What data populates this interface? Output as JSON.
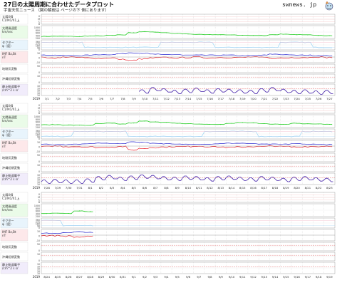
{
  "header": {
    "title": "27日の太陽周期に合わせたデータプロット",
    "subtitle": "宇宙天気ニュース （図の解説は ページの下 側にあります）",
    "logo_text": "swnews. jp"
  },
  "row_labels": [
    {
      "lines": [
        "太陽X線",
        "C1/M1/X1上"
      ],
      "bg": "#ffffff"
    },
    {
      "lines": [
        "太陽風速度",
        "km/sec"
      ],
      "bg": "#eafbe8"
    },
    {
      "lines": [
        "セクター",
        "φ（度）"
      ],
      "bg": "#e8f4fc"
    },
    {
      "lines": [
        "IMF Bz,Bt",
        "nT"
      ],
      "bg": "#fde8ea"
    },
    {
      "lines": [
        "地磁気変動"
      ],
      "bg": "#ffffff"
    },
    {
      "lines": [
        "沖縄短期変動"
      ],
      "bg": "#ffffff"
    },
    {
      "lines": [
        "静止軌道電子",
        "/cm^2 s sr"
      ],
      "bg": "#f1ecfb"
    }
  ],
  "axis_labels": {
    "xray": [
      "X",
      "M",
      "C",
      "B"
    ],
    "wind": [
      "1000",
      "800",
      "600",
      "400",
      "200"
    ],
    "sector": [
      "360",
      "270",
      "180",
      "90",
      "0"
    ],
    "imf": [
      "10",
      "0",
      "-10"
    ],
    "geomag": [
      "50",
      "0"
    ],
    "okinawa": [
      "10",
      "0"
    ],
    "electron": [
      "10",
      "10",
      "10",
      "10",
      "10"
    ]
  },
  "colors": {
    "wind": "#22cc22",
    "sector": "#9ad4f5",
    "bz": "#e8202a",
    "bt": "#2222cc",
    "electron": "#4422aa",
    "threshold": "#e05555",
    "grid": "#bbbbbb"
  },
  "chart_data": [
    {
      "type": "line",
      "year": "2019",
      "x": [
        "7/1",
        "7/2",
        "7/3",
        "7/4",
        "7/5",
        "7/6",
        "7/7",
        "7/8",
        "7/9",
        "7/10",
        "7/11",
        "7/12",
        "7/13",
        "7/14",
        "7/15",
        "7/16",
        "7/17",
        "7/18",
        "7/19",
        "7/20",
        "7/21",
        "7/22",
        "7/23",
        "7/24",
        "7/25",
        "7/26",
        "7/27"
      ],
      "series": [
        {
          "name": "太陽風速度",
          "values": [
            330,
            340,
            335,
            320,
            350,
            360,
            390,
            420,
            560,
            620,
            600,
            560,
            520,
            480,
            460,
            440,
            430,
            420,
            400,
            390,
            380,
            440,
            470,
            440,
            420,
            400,
            380
          ]
        },
        {
          "name": "セクター",
          "values": [
            270,
            270,
            270,
            270,
            90,
            90,
            90,
            90,
            90,
            90,
            90,
            270,
            270,
            270,
            270,
            270,
            90,
            90,
            90,
            90,
            90,
            90,
            270,
            270,
            270,
            90,
            90
          ]
        },
        {
          "name": "IMF Bt",
          "values": [
            4,
            4,
            3,
            3,
            4,
            5,
            5,
            7,
            9,
            8,
            6,
            5,
            5,
            4,
            4,
            4,
            4,
            4,
            3,
            3,
            4,
            6,
            5,
            4,
            4,
            3,
            3
          ]
        },
        {
          "name": "IMF Bz",
          "values": [
            -1,
            -2,
            0,
            -1,
            -2,
            -3,
            -2,
            -5,
            -7,
            -4,
            -2,
            -1,
            -2,
            -1,
            0,
            -2,
            -1,
            -1,
            -1,
            0,
            -1,
            -3,
            -2,
            -1,
            -1,
            0,
            -1
          ]
        },
        {
          "name": "静止軌道電子",
          "values": [
            null,
            null,
            null,
            null,
            null,
            null,
            null,
            null,
            null,
            10.2,
            10.6,
            10.4,
            10.1,
            10.3,
            10.5,
            10.2,
            10.4,
            10.3,
            10.2,
            10.1,
            10.4,
            10.6,
            10.3,
            10.1,
            10.2,
            10.0,
            10.1
          ]
        }
      ]
    },
    {
      "type": "line",
      "year": "2019",
      "x": [
        "7/28",
        "7/29",
        "7/30",
        "7/31",
        "8/1",
        "8/2",
        "8/3",
        "8/4",
        "8/5",
        "8/6",
        "8/7",
        "8/8",
        "8/9",
        "8/10",
        "8/11",
        "8/12",
        "8/13",
        "8/14",
        "8/15",
        "8/16",
        "8/17",
        "8/18",
        "8/19",
        "8/20",
        "8/21",
        "8/22",
        "8/23"
      ],
      "series": [
        {
          "name": "太陽風速度",
          "values": [
            370,
            380,
            360,
            350,
            340,
            450,
            470,
            420,
            480,
            600,
            560,
            520,
            470,
            440,
            420,
            400,
            390,
            460,
            520,
            490,
            450,
            420,
            400,
            470,
            440,
            420,
            400
          ]
        },
        {
          "name": "セクター",
          "values": [
            90,
            90,
            90,
            270,
            270,
            270,
            270,
            270,
            90,
            90,
            90,
            90,
            90,
            90,
            90,
            270,
            270,
            270,
            270,
            270,
            90,
            90,
            90,
            90,
            270,
            270,
            270
          ]
        },
        {
          "name": "IMF Bt",
          "values": [
            4,
            3,
            3,
            4,
            5,
            6,
            6,
            5,
            9,
            8,
            6,
            5,
            4,
            4,
            4,
            4,
            5,
            6,
            6,
            5,
            4,
            4,
            4,
            5,
            4,
            4,
            3
          ]
        },
        {
          "name": "IMF Bz",
          "values": [
            -1,
            0,
            -1,
            -1,
            -2,
            -3,
            -2,
            -1,
            -8,
            -5,
            -3,
            -2,
            -1,
            -1,
            0,
            -1,
            -2,
            -3,
            -2,
            -1,
            -1,
            0,
            -1,
            -2,
            -1,
            -1,
            0
          ]
        },
        {
          "name": "静止軌道電子",
          "values": [
            10.0,
            10.1,
            10.0,
            10.0,
            10.2,
            10.6,
            10.8,
            10.5,
            10.7,
            10.9,
            10.8,
            10.6,
            10.5,
            10.7,
            10.6,
            10.4,
            10.6,
            10.7,
            10.5,
            10.4,
            10.6,
            10.5,
            10.3,
            10.5,
            10.6,
            10.4,
            10.3
          ]
        }
      ]
    },
    {
      "type": "line",
      "year": "2019",
      "x": [
        "8/24",
        "8/25",
        "8/26",
        "8/27",
        "8/28",
        "8/29",
        "8/30",
        "8/31",
        "9/1",
        "9/2",
        "9/3",
        "9/4",
        "9/5",
        "9/6",
        "9/7",
        "9/8",
        "9/9",
        "9/10",
        "9/11",
        "9/12",
        "9/13",
        "9/14",
        "9/15",
        "9/16",
        "9/17",
        "9/18",
        "9/19"
      ],
      "series": [
        {
          "name": "太陽風速度",
          "values": [
            390,
            410,
            400,
            560,
            520,
            null,
            null,
            null,
            null,
            null,
            null,
            null,
            null,
            null,
            null,
            null,
            null,
            null,
            null,
            null,
            null,
            null,
            null,
            null,
            null,
            null,
            null
          ]
        },
        {
          "name": "セクター",
          "values": [
            270,
            270,
            90,
            90,
            90,
            null,
            null,
            null,
            null,
            null,
            null,
            null,
            null,
            null,
            null,
            null,
            null,
            null,
            null,
            null,
            null,
            null,
            null,
            null,
            null,
            null,
            null
          ]
        },
        {
          "name": "IMF Bt",
          "values": [
            4,
            4,
            5,
            7,
            6,
            null,
            null,
            null,
            null,
            null,
            null,
            null,
            null,
            null,
            null,
            null,
            null,
            null,
            null,
            null,
            null,
            null,
            null,
            null,
            null,
            null,
            null
          ]
        },
        {
          "name": "IMF Bz",
          "values": [
            -1,
            -1,
            -2,
            -4,
            -3,
            null,
            null,
            null,
            null,
            null,
            null,
            null,
            null,
            null,
            null,
            null,
            null,
            null,
            null,
            null,
            null,
            null,
            null,
            null,
            null,
            null,
            null
          ]
        }
      ]
    }
  ]
}
